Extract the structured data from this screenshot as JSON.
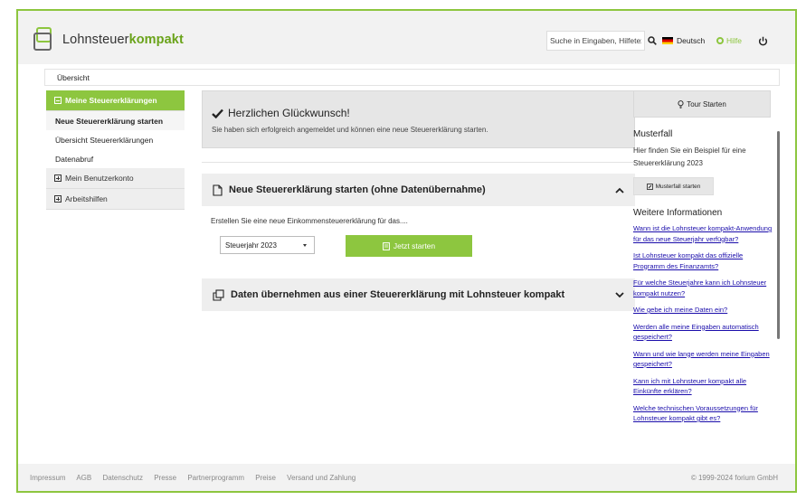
{
  "header": {
    "logo_plain": "Lohnsteuer",
    "logo_bold": "kompakt",
    "search_placeholder": "Suche in Eingaben, Hilfetexten",
    "language": "Deutsch",
    "help": "Hilfe"
  },
  "breadcrumb": "Übersicht",
  "sidebar": {
    "groups": [
      {
        "label": "Meine Steuererklärungen"
      },
      {
        "label": "Mein Benutzerkonto"
      },
      {
        "label": "Arbeitshilfen"
      }
    ],
    "sub_items": [
      {
        "label": "Neue Steuererklärung starten"
      },
      {
        "label": "Übersicht Steuererklärungen"
      },
      {
        "label": "Datenabruf"
      }
    ]
  },
  "success": {
    "title": "Herzlichen Glückwunsch!",
    "text": "Sie haben sich erfolgreich angemeldet und können eine neue Steuererklärung starten."
  },
  "panel1": {
    "title": "Neue Steuererklärung starten (ohne Datenübernahme)",
    "intro": "Erstellen Sie eine neue Einkommensteuererklärung für das....",
    "year_selected": "Steuerjahr 2023",
    "start_label": "Jetzt starten"
  },
  "panel2": {
    "title": "Daten übernehmen aus einer Steuererklärung mit Lohnsteuer kompakt"
  },
  "right": {
    "tour_label": "Tour Starten",
    "muster_title": "Musterfall",
    "muster_desc": "Hier finden Sie ein Beispiel für eine Steuererklärung 2023",
    "muster_button": "Musterfall starten",
    "info_title": "Weitere Informationen",
    "links": [
      "Wann ist die Lohnsteuer kompakt-Anwendung für das neue Steuerjahr verfügbar?",
      "Ist Lohnsteuer kompakt das offizielle Programm des Finanzamts?",
      "Für welche Steuerjahre kann ich Lohnsteuer kompakt nutzen?",
      "Wie gebe ich meine Daten ein?",
      "Werden alle meine Eingaben automatisch gespeichert?",
      "Wann und wie lange werden meine Eingaben gespeichert?",
      "Kann ich mit Lohnsteuer kompakt alle Einkünfte erklären?",
      "Welche technischen Voraussetzungen für Lohnsteuer kompakt gibt es?"
    ]
  },
  "footer": {
    "links": [
      "Impressum",
      "AGB",
      "Datenschutz",
      "Presse",
      "Partnerprogramm",
      "Preise",
      "Versand und Zahlung"
    ],
    "copyright": "© 1999-2024 forium GmbH"
  },
  "colors": {
    "accent": "#8dc63f",
    "link": "#1a0dab"
  }
}
